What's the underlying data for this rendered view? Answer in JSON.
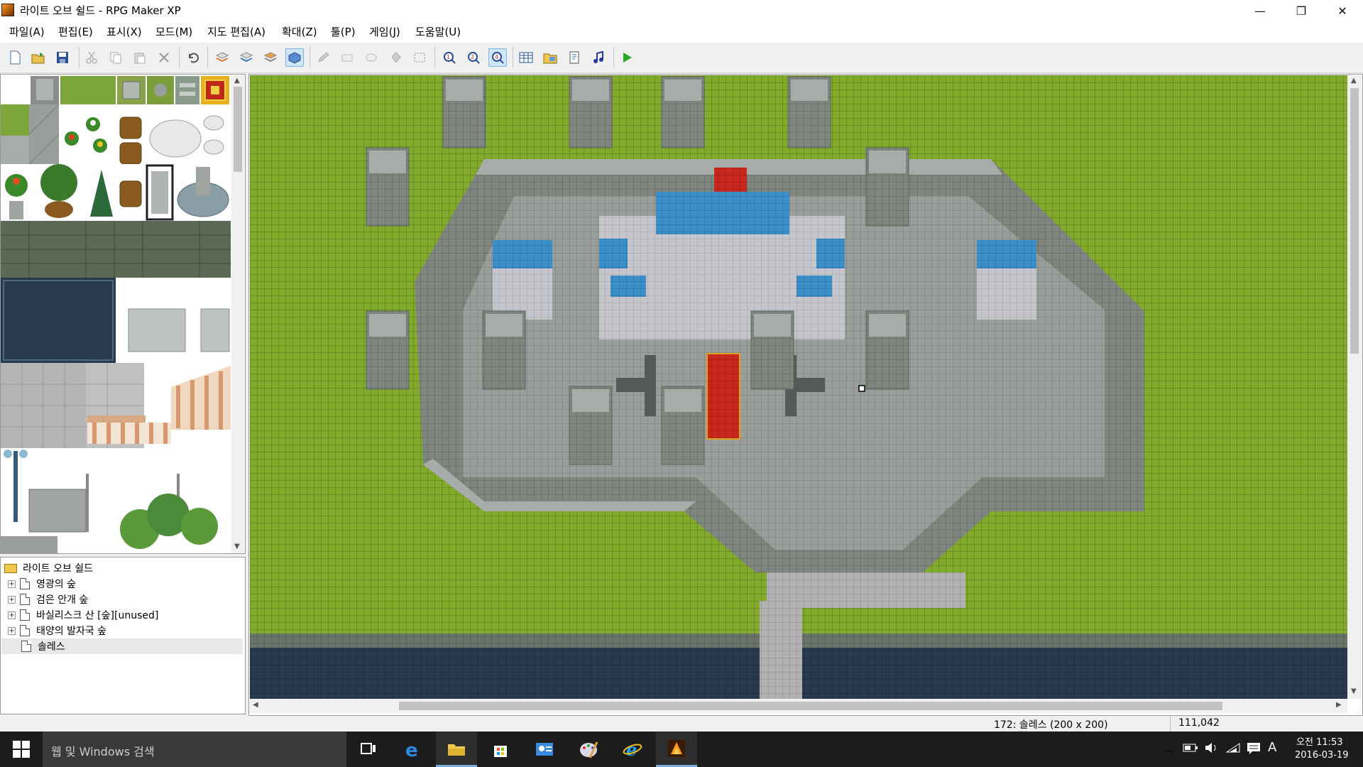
{
  "window": {
    "title": "라이트 오브 쉴드 - RPG Maker XP",
    "minimize": "—",
    "restore": "❐",
    "close": "✕"
  },
  "menu": [
    "파일(A)",
    "편집(E)",
    "표시(X)",
    "모드(M)",
    "지도 편집(A)",
    "확대(Z)",
    "툴(P)",
    "게임(J)",
    "도움말(U)"
  ],
  "toolbar": {
    "icons": [
      "new-project-icon",
      "open-project-icon",
      "save-project-icon",
      "cut-icon",
      "copy-icon",
      "paste-icon",
      "delete-icon",
      "undo-icon",
      "layer-1-icon",
      "layer-2-icon",
      "layer-3-icon",
      "event-layer-icon",
      "pencil-icon",
      "rectangle-icon",
      "ellipse-icon",
      "fill-icon",
      "select-icon",
      "zoom-1-icon",
      "zoom-2-icon",
      "zoom-4-icon",
      "database-icon",
      "materials-icon",
      "script-editor-icon",
      "sound-test-icon",
      "playtest-icon"
    ],
    "active": [
      "event-layer-icon",
      "zoom-4-icon"
    ]
  },
  "map_tree": {
    "root": "라이트 오브 쉴드",
    "items": [
      {
        "label": "영광의 숲",
        "expandable": true,
        "selected": false
      },
      {
        "label": "검은 안개 숲",
        "expandable": true,
        "selected": false
      },
      {
        "label": "바실리스크 산 [숲][unused]",
        "expandable": true,
        "selected": false
      },
      {
        "label": "태양의 발자국 숲",
        "expandable": true,
        "selected": false
      },
      {
        "label": "솔레스",
        "expandable": false,
        "selected": true
      }
    ]
  },
  "status": {
    "map_info": "172: 솔레스 (200 x 200)",
    "coordinates": "111,042"
  },
  "taskbar": {
    "search_placeholder": "웹 및 Windows 검색",
    "time": "11:53",
    "ampm": "오전",
    "date": "2016-03-19",
    "ime": "A",
    "apps": [
      "task-view-icon",
      "edge-icon",
      "file-explorer-icon",
      "store-icon",
      "contacts-icon",
      "paint-icon",
      "internet-explorer-icon",
      "rpg-maker-icon"
    ]
  },
  "colors": {
    "grass": "#82ab2c",
    "stone": "#9a9e9a",
    "wall": "#7f857f",
    "roof": "#3b8fc6",
    "carpet": "#c8281e",
    "water": "#2a3a4e",
    "selection": "#cfe6fa"
  }
}
